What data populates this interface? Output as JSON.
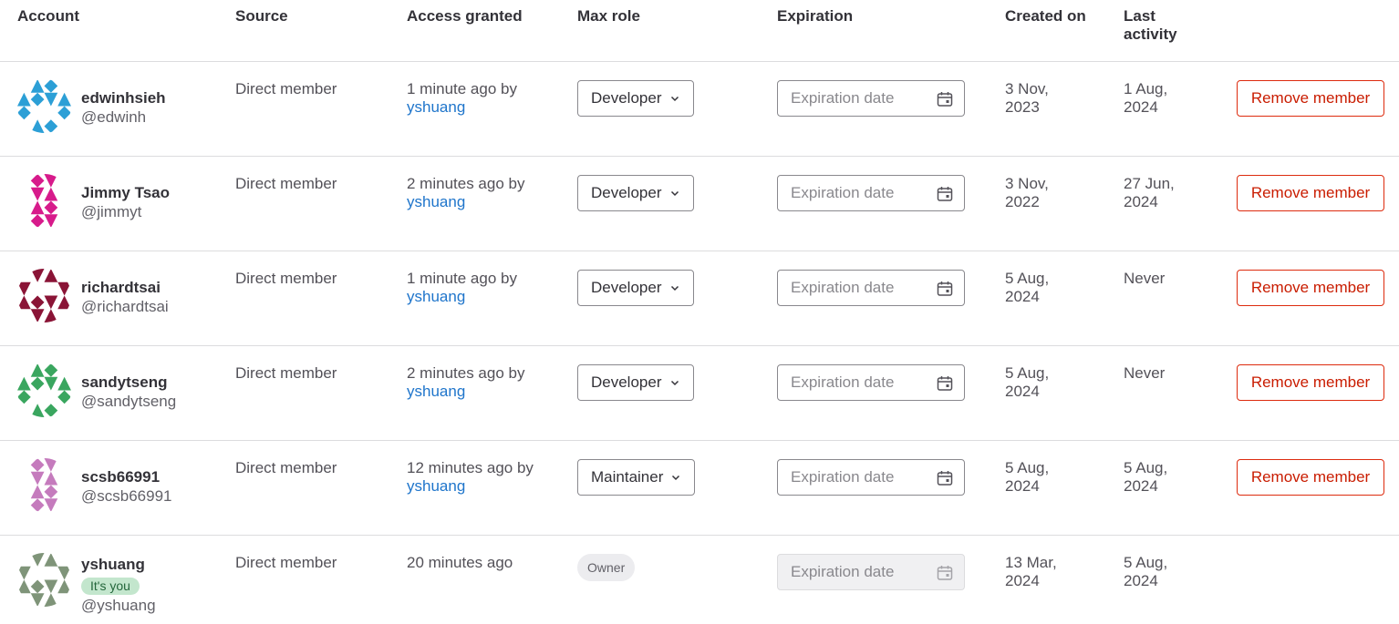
{
  "headers": {
    "account": "Account",
    "source": "Source",
    "access_granted": "Access granted",
    "max_role": "Max role",
    "expiration": "Expiration",
    "created_on": "Created on",
    "last_activity_1": "Last",
    "last_activity_2": "activity"
  },
  "expiration_placeholder": "Expiration date",
  "remove_label": "Remove member",
  "owner_label": "Owner",
  "you_badge": "It's you",
  "members": [
    {
      "name": "edwinhsieh",
      "handle": "@edwinh",
      "source": "Direct member",
      "access": "1 minute ago by",
      "granted_by": "yshuang",
      "role": "Developer",
      "created_1": "3 Nov,",
      "created_2": "2023",
      "last_1": "1 Aug,",
      "last_2": "2024",
      "avatar_color": "#2c9fd6"
    },
    {
      "name": "Jimmy Tsao",
      "handle": "@jimmyt",
      "source": "Direct member",
      "access": "2 minutes ago by",
      "granted_by": "yshuang",
      "role": "Developer",
      "created_1": "3 Nov,",
      "created_2": "2022",
      "last_1": "27 Jun,",
      "last_2": "2024",
      "avatar_color": "#d71b8b"
    },
    {
      "name": "richardtsai",
      "handle": "@richardtsai",
      "source": "Direct member",
      "access": "1 minute ago by",
      "granted_by": "yshuang",
      "role": "Developer",
      "created_1": "5 Aug,",
      "created_2": "2024",
      "last_1": "Never",
      "last_2": "",
      "avatar_color": "#8a1436"
    },
    {
      "name": "sandytseng",
      "handle": "@sandytseng",
      "source": "Direct member",
      "access": "2 minutes ago by",
      "granted_by": "yshuang",
      "role": "Developer",
      "created_1": "5 Aug,",
      "created_2": "2024",
      "last_1": "Never",
      "last_2": "",
      "avatar_color": "#3aa65f"
    },
    {
      "name": "scsb66991",
      "handle": "@scsb66991",
      "source": "Direct member",
      "access": "12 minutes ago by",
      "granted_by": "yshuang",
      "role": "Maintainer",
      "created_1": "5 Aug,",
      "created_2": "2024",
      "last_1": "5 Aug,",
      "last_2": "2024",
      "avatar_color": "#c57bbd"
    },
    {
      "name": "yshuang",
      "handle": "@yshuang",
      "source": "Direct member",
      "access": "20 minutes ago",
      "granted_by": "",
      "role": "Owner",
      "created_1": "13 Mar,",
      "created_2": "2024",
      "last_1": "5 Aug,",
      "last_2": "2024",
      "avatar_color": "#7f9479"
    }
  ]
}
